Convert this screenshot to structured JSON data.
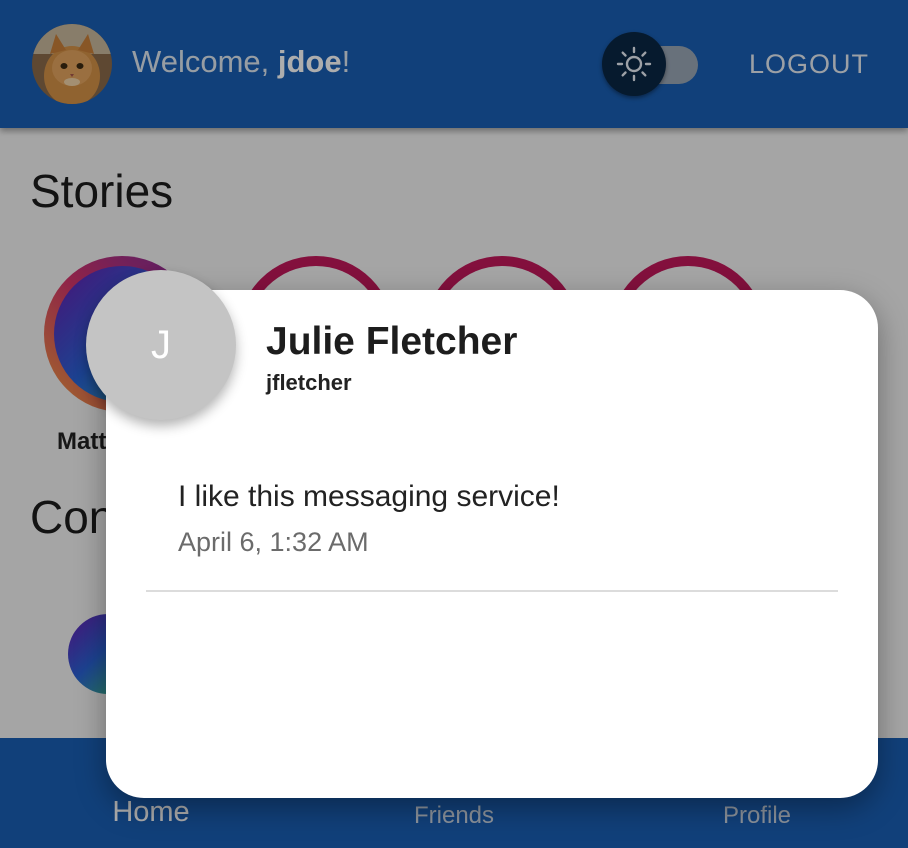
{
  "header": {
    "welcome_prefix": "Welcome, ",
    "username": "jdoe",
    "welcome_suffix": "!",
    "logout_label": "LOGOUT",
    "theme_toggle_icon": "sun-icon"
  },
  "stories": {
    "title": "Stories",
    "items": [
      {
        "name": "Matt"
      }
    ]
  },
  "contacts": {
    "title": "Con"
  },
  "nav": {
    "items": [
      {
        "label": "Home",
        "icon": "home-icon"
      },
      {
        "label": "Friends",
        "icon": "friends-icon"
      },
      {
        "label": "Profile",
        "icon": "profile-icon"
      }
    ],
    "active": "Home"
  },
  "dialog": {
    "avatar_initial": "J",
    "name": "Julie Fletcher",
    "username": "jfletcher",
    "message": "I like this messaging service!",
    "timestamp": "April 6, 1:32 AM"
  },
  "colors": {
    "primary": "#1a5fb4",
    "story_ring": "#c2185b",
    "scrim": "rgba(0,0,0,0.32)"
  }
}
